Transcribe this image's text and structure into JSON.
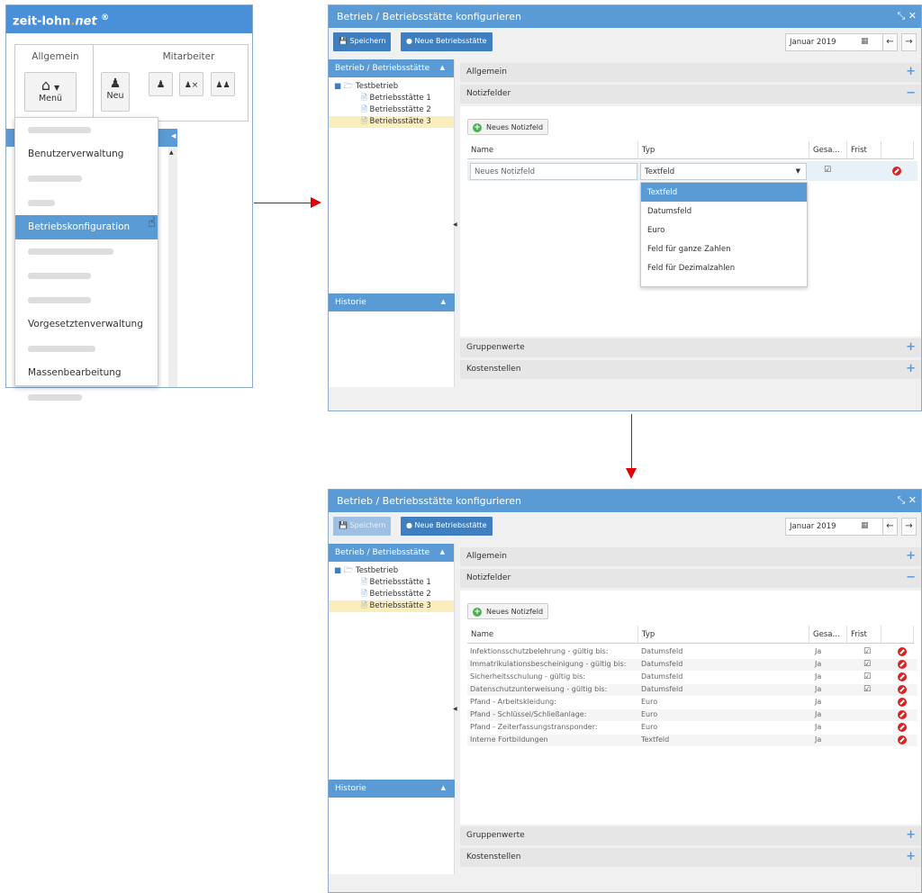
{
  "left_panel": {
    "brand_main": "zeit-lohn",
    "brand_dot": ".",
    "brand_net": "net",
    "brand_reg": "®",
    "group_allgemein": "Allgemein",
    "group_mitarbeiter": "Mitarbeiter",
    "menu_button_label": "Menü",
    "new_button_label": "Neu",
    "menu_items": [
      {
        "label": "",
        "blurred": true
      },
      {
        "label": "Benutzerverwaltung",
        "blurred": false
      },
      {
        "label": "",
        "blurred": true
      },
      {
        "label": "",
        "blurred": true
      },
      {
        "label": "Betriebskonfiguration",
        "blurred": false,
        "active": true
      },
      {
        "label": "",
        "blurred": true
      },
      {
        "label": "",
        "blurred": true
      },
      {
        "label": "",
        "blurred": true
      },
      {
        "label": "Vorgesetztenverwaltung",
        "blurred": false
      },
      {
        "label": "",
        "blurred": true
      },
      {
        "label": "Massenbearbeitung",
        "blurred": false
      },
      {
        "label": "",
        "blurred": true
      }
    ]
  },
  "dialog": {
    "title": "Betrieb / Betriebsstätte konfigurieren",
    "save_label": "Speichern",
    "new_site_label": "Neue Betriebsstätte",
    "date_value": "Januar 2019",
    "side_header": "Betrieb / Betriebsstätte",
    "history_header": "Historie",
    "tree": {
      "root": "Testbetrieb",
      "children": [
        "Betriebsstätte 1",
        "Betriebsstätte 2",
        "Betriebsstätte 3"
      ]
    },
    "sections": {
      "allgemein": "Allgemein",
      "notizfelder": "Notizfelder",
      "gruppenwerte": "Gruppenwerte",
      "kostenstellen": "Kostenstellen"
    },
    "new_field_label": "Neues Notizfeld",
    "columns": {
      "name": "Name",
      "typ": "Typ",
      "gesa": "Gesa...",
      "frist": "Frist"
    }
  },
  "dialog1": {
    "edit_name_value": "Neues Notizfeld",
    "edit_type_value": "Textfeld",
    "dropdown_options": [
      "Textfeld",
      "Datumsfeld",
      "Euro",
      "Feld für ganze Zahlen",
      "Feld für Dezimalzahlen"
    ]
  },
  "dialog2": {
    "rows": [
      {
        "name": "Infektionsschutzbelehrung - gültig bis:",
        "typ": "Datumsfeld",
        "gesa": "Ja",
        "frist": true
      },
      {
        "name": "Immatrikulationsbescheinigung - gültig bis:",
        "typ": "Datumsfeld",
        "gesa": "Ja",
        "frist": true
      },
      {
        "name": "Sicherheitsschulung - gültig bis:",
        "typ": "Datumsfeld",
        "gesa": "Ja",
        "frist": true
      },
      {
        "name": "Datenschutzunterweisung - gültig bis:",
        "typ": "Datumsfeld",
        "gesa": "Ja",
        "frist": true
      },
      {
        "name": "Pfand - Arbeitskleidung:",
        "typ": "Euro",
        "gesa": "Ja",
        "frist": false
      },
      {
        "name": "Pfand - Schlüssel/Schließanlage:",
        "typ": "Euro",
        "gesa": "Ja",
        "frist": false
      },
      {
        "name": "Pfand - Zeiterfassungstransponder:",
        "typ": "Euro",
        "gesa": "Ja",
        "frist": false
      },
      {
        "name": "Interne Fortbildungen",
        "typ": "Textfeld",
        "gesa": "Ja",
        "frist": false
      }
    ]
  },
  "colors": {
    "accent": "#5b9bd5",
    "arrow": "#e00000",
    "selected_tree": "#fbeebd",
    "delete": "#e02020"
  }
}
